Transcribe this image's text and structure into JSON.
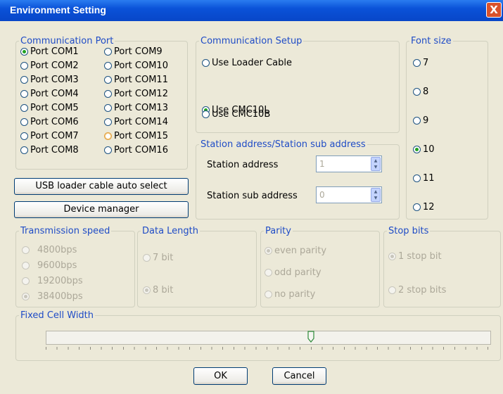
{
  "window": {
    "title": "Environment Setting",
    "close_glyph": "X"
  },
  "communication_port": {
    "legend": "Communication Port",
    "ports": [
      "Port COM1",
      "Port COM2",
      "Port COM3",
      "Port COM4",
      "Port COM5",
      "Port COM6",
      "Port COM7",
      "Port COM8",
      "Port COM9",
      "Port COM10",
      "Port COM11",
      "Port COM12",
      "Port COM13",
      "Port COM14",
      "Port COM15",
      "Port COM16"
    ],
    "selected": "Port COM1",
    "hovered": "Port COM15"
  },
  "buttons": {
    "usb_auto": "USB loader cable auto select",
    "device_manager": "Device manager",
    "ok": "OK",
    "cancel": "Cancel"
  },
  "communication_setup": {
    "legend": "Communication Setup",
    "options": [
      "Use Loader Cable",
      "Use CMC10L",
      "Use CMC10B"
    ],
    "selected": "Use CMC10L"
  },
  "station": {
    "legend": "Station address/Station sub address",
    "address_label": "Station address",
    "address_value": "1",
    "sub_label": "Station sub address",
    "sub_value": "0"
  },
  "font_size": {
    "legend": "Font size",
    "options": [
      "7",
      "8",
      "9",
      "10",
      "11",
      "12"
    ],
    "selected": "10"
  },
  "transmission_speed": {
    "legend": "Transmission speed",
    "options": [
      "4800bps",
      "9600bps",
      "19200bps",
      "38400bps"
    ],
    "selected": "38400bps"
  },
  "data_length": {
    "legend": "Data Length",
    "options": [
      "7 bit",
      "8 bit"
    ],
    "selected": "8 bit"
  },
  "parity": {
    "legend": "Parity",
    "options": [
      "even parity",
      "odd  parity",
      "no parity"
    ],
    "selected": "even parity"
  },
  "stop_bits": {
    "legend": "Stop bits",
    "options": [
      "1 stop bit",
      "2 stop bits"
    ],
    "selected": "1 stop bit"
  },
  "fixed_cell_width": {
    "legend": "Fixed Cell Width",
    "slider_value_fraction": 0.6
  }
}
